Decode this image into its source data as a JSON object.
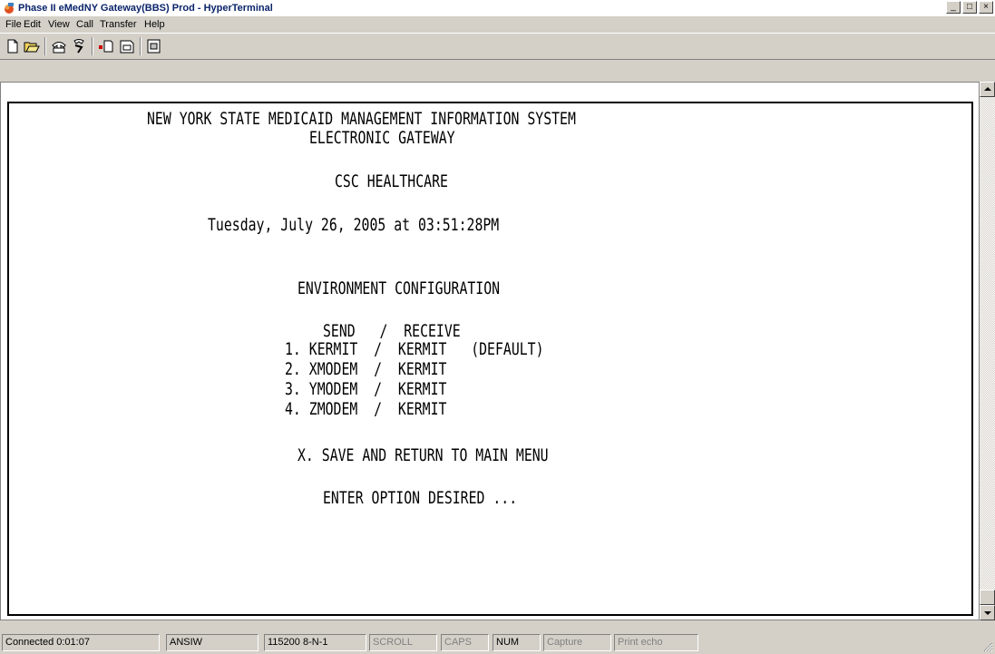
{
  "window": {
    "title": "Phase II eMedNY Gateway(BBS) Prod - HyperTerminal",
    "controls": [
      "_",
      "□",
      "×"
    ]
  },
  "menu": [
    "File",
    "Edit",
    "View",
    "Call",
    "Transfer",
    "Help"
  ],
  "toolbar": {
    "buttons": [
      "new-icon",
      "open-icon",
      "connect-icon",
      "disconnect-icon",
      "send-icon",
      "receive-icon",
      "properties-icon"
    ]
  },
  "terminal": {
    "lines": [
      "NEW YORK STATE MEDICAID MANAGEMENT INFORMATION SYSTEM",
      "ELECTRONIC GATEWAY",
      "CSC HEALTHCARE",
      "Tuesday, July 26, 2005 at 03:51:28PM",
      "ENVIRONMENT CONFIGURATION",
      "SEND   /  RECEIVE",
      "1. KERMIT  /  KERMIT   (DEFAULT)",
      "2. XMODEM  /  KERMIT",
      "3. YMODEM  /  KERMIT",
      "4. ZMODEM  /  KERMIT",
      "X. SAVE AND RETURN TO MAIN MENU",
      "ENTER OPTION DESIRED ..."
    ]
  },
  "status": {
    "connected": "Connected 0:01:07",
    "emulation": "ANSIW",
    "settings": "115200 8-N-1",
    "scroll": "SCROLL",
    "caps": "CAPS",
    "num": "NUM",
    "capture": "Capture",
    "print_echo": "Print echo"
  }
}
